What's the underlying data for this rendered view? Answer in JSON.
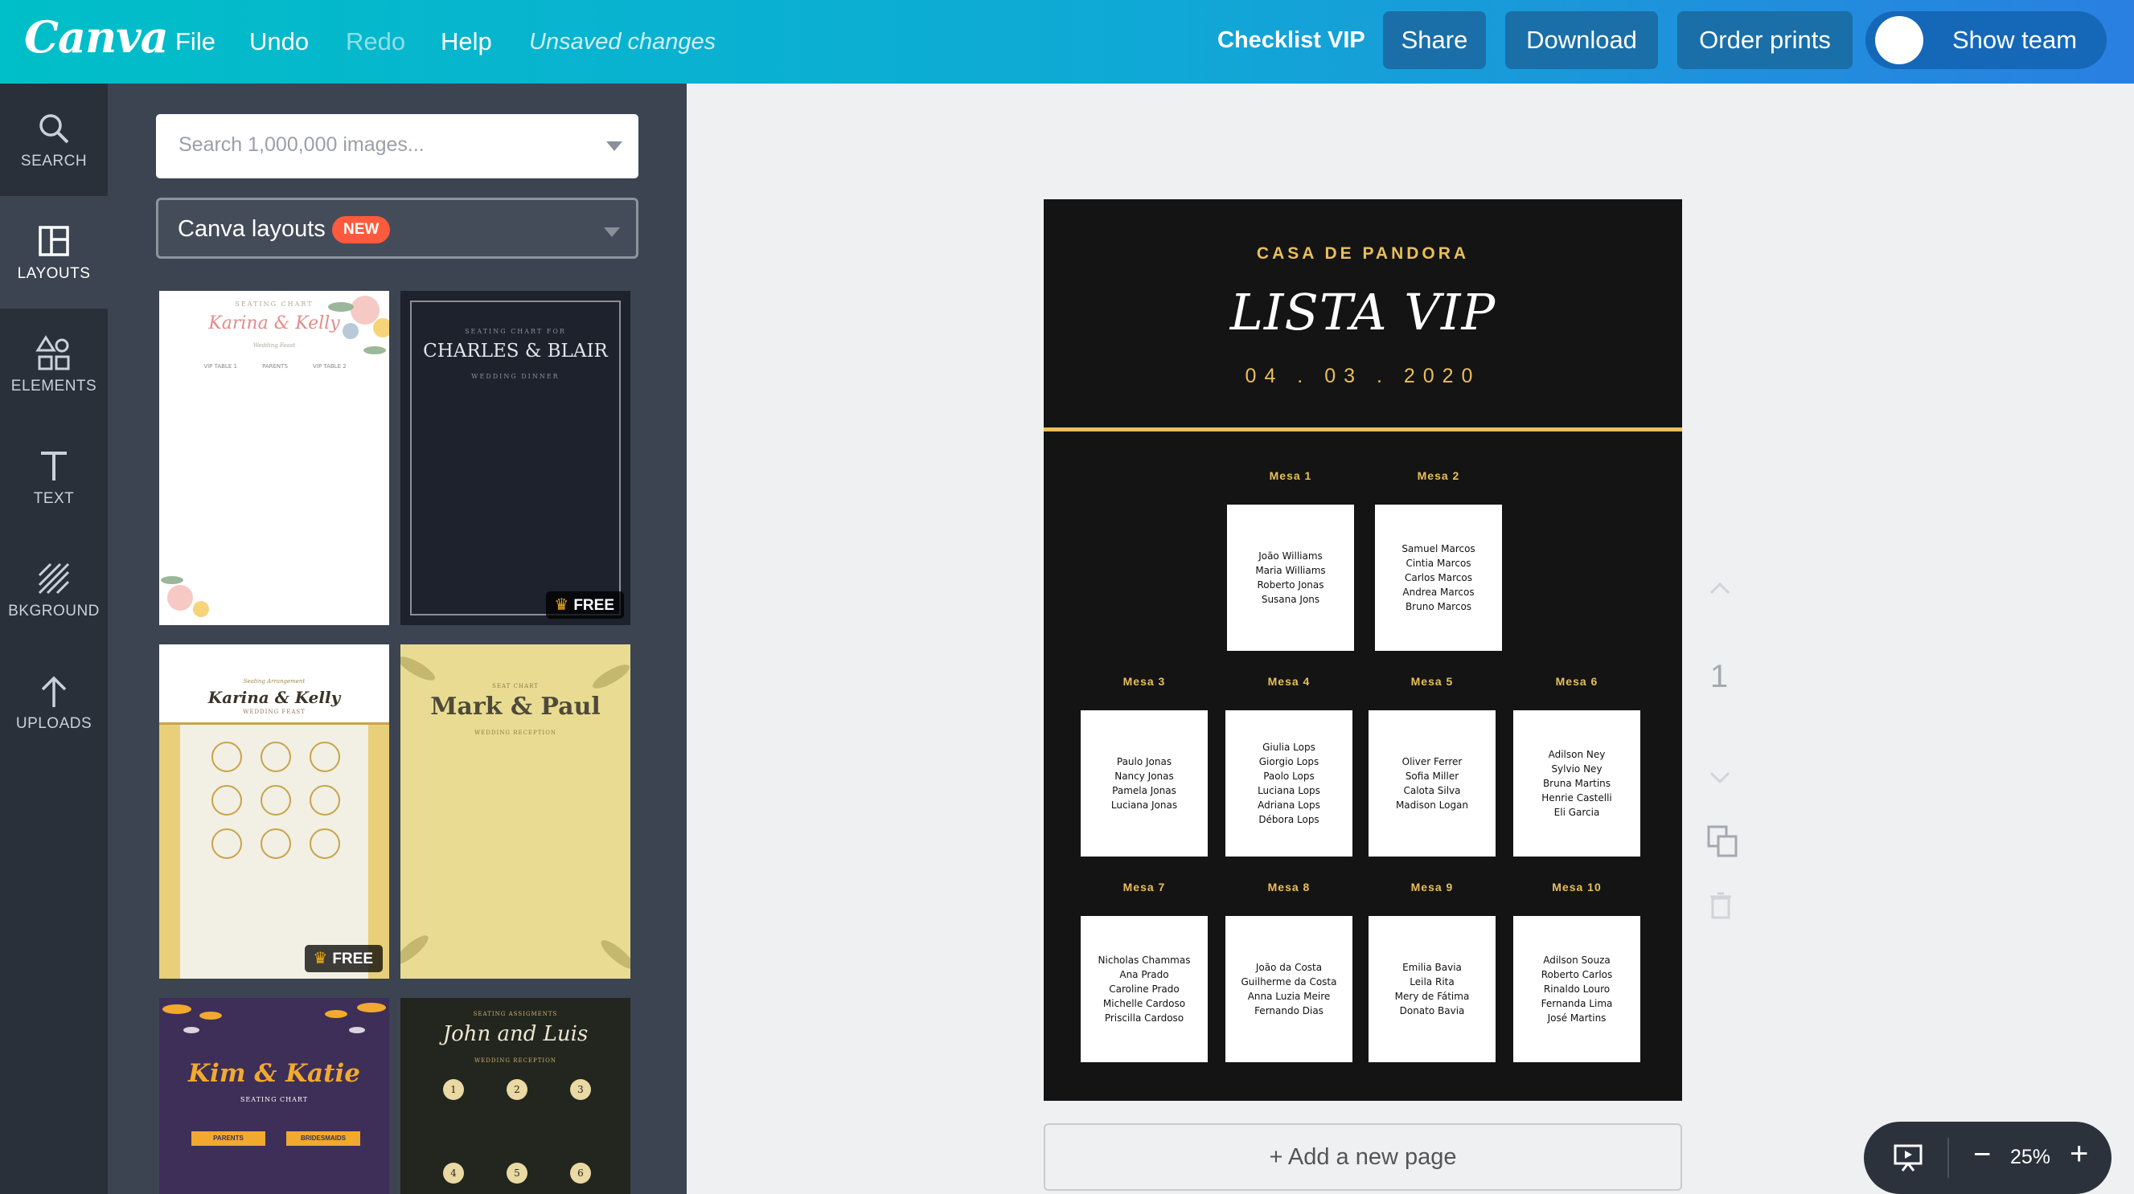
{
  "topbar": {
    "logo": "Canva",
    "menu": {
      "file": "File",
      "undo": "Undo",
      "redo": "Redo",
      "help": "Help"
    },
    "status": "Unsaved changes",
    "doc_title": "Checklist VIP",
    "share": "Share",
    "download": "Download",
    "order_prints": "Order prints",
    "show_team": "Show team"
  },
  "rail": {
    "search": "SEARCH",
    "layouts": "LAYOUTS",
    "elements": "ELEMENTS",
    "text": "TEXT",
    "background": "BKGROUND",
    "uploads": "UPLOADS"
  },
  "panel": {
    "search_placeholder": "Search 1,000,000 images...",
    "category": "Canva layouts",
    "category_badge": "NEW",
    "free_label": "FREE",
    "thumbs": [
      {
        "heading": "SEATING CHART",
        "title": "Karina & Kelly",
        "sub": "Wedding Feast"
      },
      {
        "heading": "SEATING CHART FOR",
        "title": "CHARLES & BLAIR",
        "sub": "WEDDING DINNER"
      },
      {
        "heading": "Seating Arrangement",
        "title": "Karina & Kelly",
        "sub": "WEDDING FEAST"
      },
      {
        "heading": "SEAT CHART",
        "title": "Mark & Paul",
        "sub": "WEDDING RECEPTION"
      },
      {
        "title": "Kim & Katie",
        "sub": "SEATING CHART",
        "tags": [
          "PARENTS",
          "BRIDESMAIDS"
        ]
      },
      {
        "heading": "SEATING ASSIGMENTS",
        "title": "John and Luis",
        "sub": "WEDDING RECEPTION"
      }
    ]
  },
  "document": {
    "venue": "CASA DE PANDORA",
    "title": "LISTA VIP",
    "date": "04 . 03 . 2020",
    "tables": [
      {
        "label": "Mesa 1",
        "guests": [
          "João Williams",
          "Maria Williams",
          "Roberto Jonas",
          "Susana Jons"
        ]
      },
      {
        "label": "Mesa 2",
        "guests": [
          "Samuel Marcos",
          "Cintia Marcos",
          "Carlos Marcos",
          "Andrea Marcos",
          "Bruno Marcos"
        ]
      },
      {
        "label": "Mesa 3",
        "guests": [
          "Paulo Jonas",
          "Nancy Jonas",
          "Pamela Jonas",
          "Luciana Jonas"
        ]
      },
      {
        "label": "Mesa 4",
        "guests": [
          "Giulia Lops",
          "Giorgio Lops",
          "Paolo Lops",
          "Luciana Lops",
          "Adriana Lops",
          "Débora Lops"
        ]
      },
      {
        "label": "Mesa 5",
        "guests": [
          "Oliver Ferrer",
          "Sofia Miller",
          "Calota Silva",
          "Madison Logan"
        ]
      },
      {
        "label": "Mesa 6",
        "guests": [
          "Adilson Ney",
          "Sylvio Ney",
          "Bruna Martins",
          "Henrie Castelli",
          "Eli Garcia"
        ]
      },
      {
        "label": "Mesa 7",
        "guests": [
          "Nicholas Chammas",
          "Ana Prado",
          "Caroline Prado",
          "Michelle Cardoso",
          "Priscilla Cardoso"
        ]
      },
      {
        "label": "Mesa 8",
        "guests": [
          "João da Costa",
          "Guilherme da Costa",
          "Anna Luzia Meire",
          "Fernando Dias"
        ]
      },
      {
        "label": "Mesa 9",
        "guests": [
          "Emilia Bavia",
          "Leila Rita",
          "Mery de Fátima",
          "Donato Bavia"
        ]
      },
      {
        "label": "Mesa 10",
        "guests": [
          "Adilson Souza",
          "Roberto Carlos",
          "Rinaldo Louro",
          "Fernanda Lima",
          "José Martins"
        ]
      }
    ]
  },
  "canvas": {
    "add_page": "+ Add a new page",
    "page_number": "1",
    "zoom": "25%"
  },
  "colors": {
    "accent_gold": "#e9bf5a",
    "topbar_start": "#00bfc8",
    "topbar_end": "#2a7fe0",
    "rail": "#293039",
    "panel": "#3c4451",
    "badge": "#ff5a3c"
  }
}
